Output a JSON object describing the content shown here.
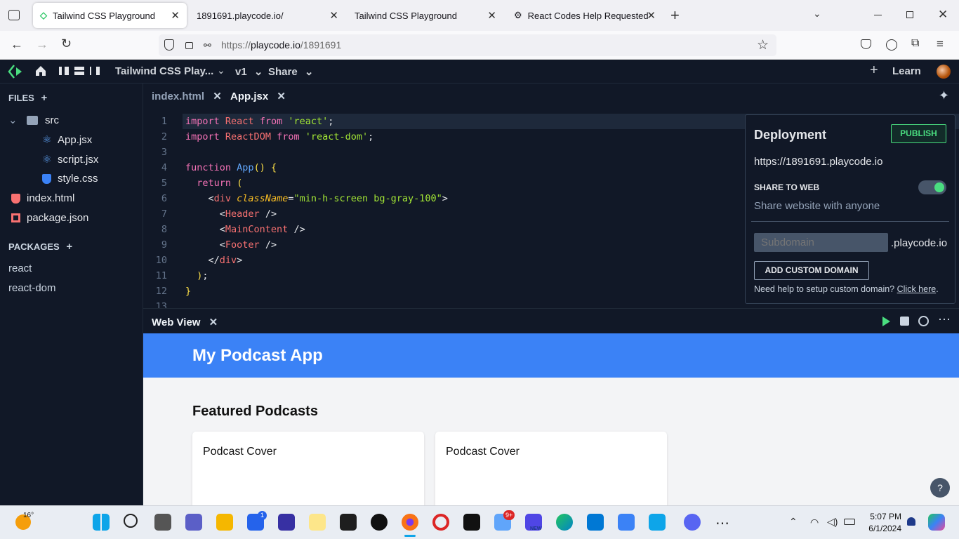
{
  "browser": {
    "tabs": [
      {
        "title": "Tailwind CSS Playground"
      },
      {
        "title": "1891691.playcode.io/"
      },
      {
        "title": "Tailwind CSS Playground"
      },
      {
        "title": "React Codes Help Requested"
      }
    ],
    "url_prefix": "https://",
    "url_host": "playcode.io",
    "url_path": "/1891691"
  },
  "appbar": {
    "project_title": "Tailwind CSS Play...",
    "version": "v1",
    "share": "Share",
    "learn": "Learn"
  },
  "sidebar": {
    "files_header": "FILES",
    "files": [
      {
        "name": "src",
        "type": "folder"
      },
      {
        "name": "App.jsx",
        "type": "react"
      },
      {
        "name": "script.jsx",
        "type": "react"
      },
      {
        "name": "style.css",
        "type": "css"
      },
      {
        "name": "index.html",
        "type": "html"
      },
      {
        "name": "package.json",
        "type": "json"
      }
    ],
    "packages_header": "PACKAGES",
    "packages": [
      "react",
      "react-dom"
    ]
  },
  "editor": {
    "tabs": [
      {
        "label": "index.html",
        "active": false
      },
      {
        "label": "App.jsx",
        "active": true
      }
    ],
    "line_numbers": [
      "1",
      "2",
      "3",
      "4",
      "5",
      "6",
      "7",
      "8",
      "9",
      "10",
      "11",
      "12",
      "13"
    ],
    "code_lines": [
      "import React from 'react';",
      "import ReactDOM from 'react-dom';",
      "",
      "function App() {",
      "  return (",
      "    <div className=\"min-h-screen bg-gray-100\">",
      "      <Header />",
      "      <MainContent />",
      "      <Footer />",
      "    </div>",
      "  );",
      "}"
    ]
  },
  "deployment": {
    "title": "Deployment",
    "publish": "PUBLISH",
    "url": "https://1891691.playcode.io",
    "share_heading": "SHARE TO WEB",
    "share_desc": "Share website with anyone",
    "share_enabled": true,
    "subdomain_placeholder": "Subdomain",
    "domain_suffix": ".playcode.io",
    "custom_domain_button": "ADD CUSTOM DOMAIN",
    "help_text": "Need help to setup custom domain?",
    "help_link": "Click here",
    "help_period": "."
  },
  "webview": {
    "tab_label": "Web View",
    "header_title": "My Podcast App",
    "section_title": "Featured Podcasts",
    "cards": [
      {
        "title": "Podcast Cover"
      },
      {
        "title": "Podcast Cover"
      }
    ],
    "help_button": "?"
  },
  "taskbar": {
    "weather": "16°",
    "time": "5:07 PM",
    "date": "6/1/2024",
    "badges": {
      "store": "1",
      "app": "9+",
      "teams": "NEW"
    }
  },
  "colors": {
    "accent_green": "#4ade80",
    "preview_header": "#3b82f6",
    "editor_bg": "#111827"
  }
}
